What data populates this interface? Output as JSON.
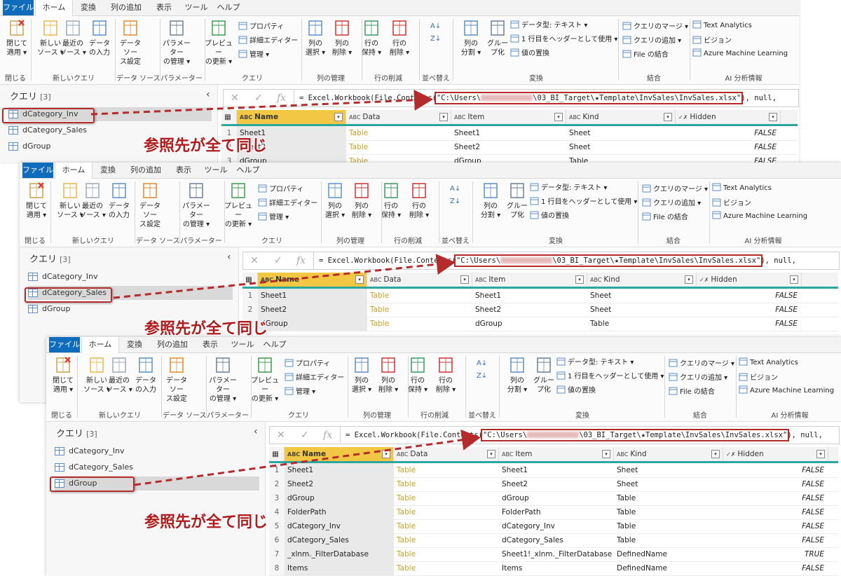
{
  "tabs": [
    "ファイル",
    "ホーム",
    "変換",
    "列の追加",
    "表示",
    "ツール",
    "ヘルプ"
  ],
  "ribbon": {
    "close_apply": [
      "閉じて",
      "適用 ▾"
    ],
    "new_source": [
      "新しい",
      "ソース ▾"
    ],
    "recent_sources": [
      "最近の",
      "ソース ▾"
    ],
    "enter_data": [
      "データ",
      "の入力"
    ],
    "data_source_settings": [
      "データ ソー",
      "ス設定"
    ],
    "manage_params": [
      "パラメーター",
      "の管理 ▾"
    ],
    "refresh_preview": [
      "プレビュー",
      "の更新 ▾"
    ],
    "properties": "プロパティ",
    "advanced_editor": "詳細エディター",
    "manage": "管理 ▾",
    "choose_columns": [
      "列の",
      "選択 ▾"
    ],
    "remove_columns": [
      "列の",
      "削除 ▾"
    ],
    "keep_rows": [
      "行の",
      "保持 ▾"
    ],
    "remove_rows": [
      "行の",
      "削除 ▾"
    ],
    "split_column": [
      "列の",
      "分割 ▾"
    ],
    "group_by": [
      "グルー",
      "プ化"
    ],
    "data_type": "データ型: テキスト ▾",
    "first_row_headers": "1 行目をヘッダーとして使用 ▾",
    "replace_values": "値の置換",
    "merge_queries": "クエリのマージ ▾",
    "append_queries": "クエリの追加 ▾",
    "combine_files": "File の結合",
    "text_analytics": "Text Analytics",
    "vision": "ビジョン",
    "azure_ml": "Azure Machine Learning",
    "groups": [
      "閉じる",
      "新しいクエリ",
      "データ ソース",
      "パラメーター",
      "クエリ",
      "列の管理",
      "行の削減",
      "並べ替え",
      "変換",
      "結合",
      "AI 分析情報"
    ]
  },
  "queries_pane": {
    "title": "クエリ",
    "count": "[3]",
    "items": [
      "dCategory_Inv",
      "dCategory_Sales",
      "dGroup"
    ]
  },
  "formula": {
    "prefix": "= Excel.Workbook(File.Contents(",
    "path_start": "\"C:\\Users\\",
    "path_end": "\\03_BI_Target\\★Template\\InvSales\\InvSales.xlsx\"",
    "suffix": "), null,"
  },
  "columns": [
    "Name",
    "Data",
    "Item",
    "Kind",
    "Hidden"
  ],
  "rows": [
    {
      "n": "1",
      "name": "Sheet1",
      "data": "Table",
      "item": "Sheet1",
      "kind": "Sheet",
      "hidden": "FALSE"
    },
    {
      "n": "2",
      "name": "Sheet2",
      "data": "Table",
      "item": "Sheet2",
      "kind": "Sheet",
      "hidden": "FALSE"
    },
    {
      "n": "3",
      "name": "dGroup",
      "data": "Table",
      "item": "dGroup",
      "kind": "Table",
      "hidden": "FALSE"
    },
    {
      "n": "4",
      "name": "FolderPath",
      "data": "Table",
      "item": "FolderPath",
      "kind": "Table",
      "hidden": "FALSE"
    },
    {
      "n": "5",
      "name": "dCategory_Inv",
      "data": "Table",
      "item": "dCategory_Inv",
      "kind": "Table",
      "hidden": "FALSE"
    },
    {
      "n": "6",
      "name": "dCategory_Sales",
      "data": "Table",
      "item": "dCategory_Sales",
      "kind": "Table",
      "hidden": "FALSE"
    },
    {
      "n": "7",
      "name": "_xlnm._FilterDatabase",
      "data": "Table",
      "item": "Sheet1!_xlnm._FilterDatabase",
      "kind": "DefinedName",
      "hidden": "TRUE"
    },
    {
      "n": "8",
      "name": "Items",
      "data": "Table",
      "item": "Items",
      "kind": "DefinedName",
      "hidden": "FALSE"
    }
  ],
  "callout": "参照先が全て同じ",
  "colors": {
    "accent": "#0f6cbd",
    "annotation_red": "#b52a2a",
    "header_yellow": "#f2c744",
    "teal": "#2aa8a0"
  },
  "icons": [
    "close-apply-icon",
    "new-source-icon",
    "recent-sources-icon",
    "enter-data-icon",
    "settings-gear-icon",
    "parameters-icon",
    "refresh-icon",
    "table-icon",
    "collapse-chevron-icon",
    "fx-icon"
  ]
}
